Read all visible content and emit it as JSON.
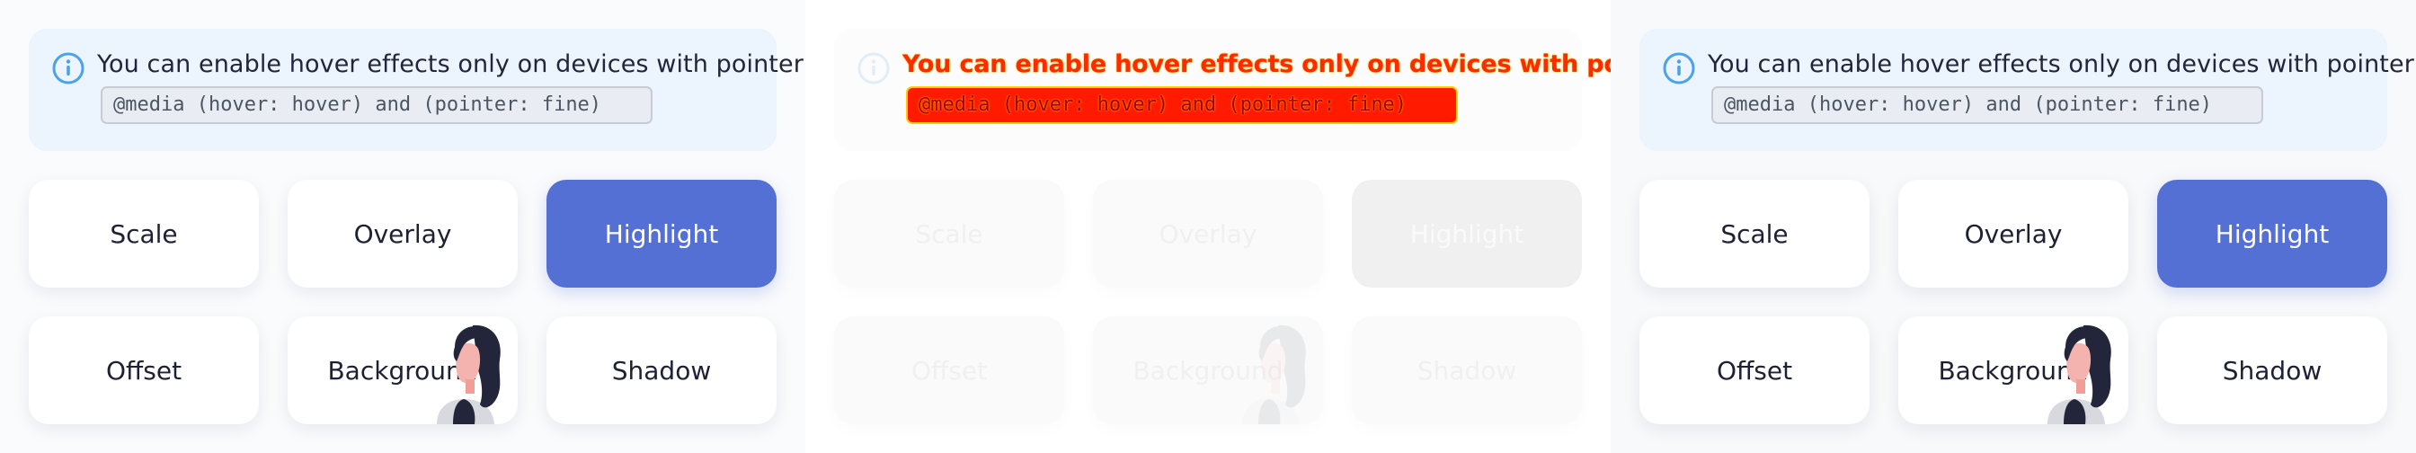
{
  "info": {
    "message": "You can enable hover effects only on devices with pointer:",
    "code": "@media (hover: hover) and (pointer: fine)",
    "icon": "info-circle-icon"
  },
  "buttons": {
    "scale": "Scale",
    "overlay": "Overlay",
    "highlight": "Highlight",
    "offset": "Offset",
    "background": "Background",
    "shadow": "Shadow"
  },
  "colors": {
    "accent": "#5470d4",
    "info_bg": "#ecf4fd",
    "info_icon": "#4aa3e8",
    "text": "#1e2133"
  },
  "avatar_icon": "woman-avatar-icon"
}
